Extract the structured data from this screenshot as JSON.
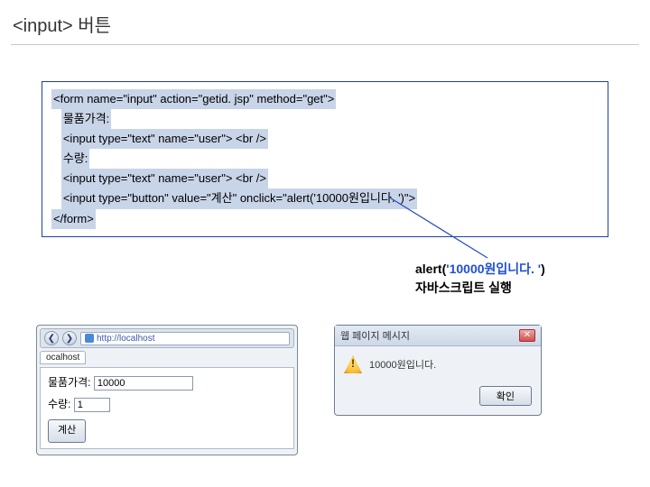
{
  "title": "<input> 버튼",
  "code": {
    "line1": "<form name=\"input\" action=\"getid. jsp\" method=\"get\">",
    "line2": "물품가격:",
    "line3": "<input type=\"text\" name=\"user\"> <br />",
    "line4": "수량:",
    "line5": "<input type=\"text\" name=\"user\"> <br />",
    "line6": "<input type=\"button\" value=\"계산\" onclick=\"alert('10000원입니다. ')\">",
    "line7": "</form>"
  },
  "caption": {
    "fn": "alert",
    "paren_open": "(",
    "arg": "'10000원입니다. '",
    "paren_close": ")",
    "desc": "자바스크립트 실행"
  },
  "browser": {
    "tab_active": "ocalhost",
    "url": "http://localhost",
    "label_price": "물품가격:",
    "value_price": "10000",
    "label_qty": "수량:",
    "value_qty": "1",
    "button": "계산"
  },
  "dialog": {
    "title": "웹 페이지 메시지",
    "message": "10000원입니다.",
    "ok": "확인"
  }
}
